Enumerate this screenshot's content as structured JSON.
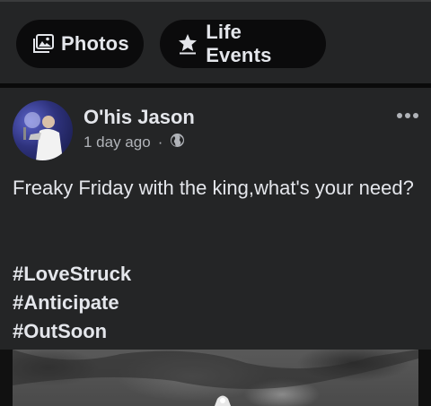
{
  "filters": {
    "photos_label": "Photos",
    "life_events_label": "Life Events"
  },
  "post": {
    "author": "O'his Jason",
    "time": "1 day ago",
    "separator": "·",
    "audience_icon": "globe-icon",
    "text": "Freaky Friday with the king,what's your need?",
    "hashtags": [
      "#LoveStruck",
      "#Anticipate",
      "#OutSoon"
    ]
  }
}
